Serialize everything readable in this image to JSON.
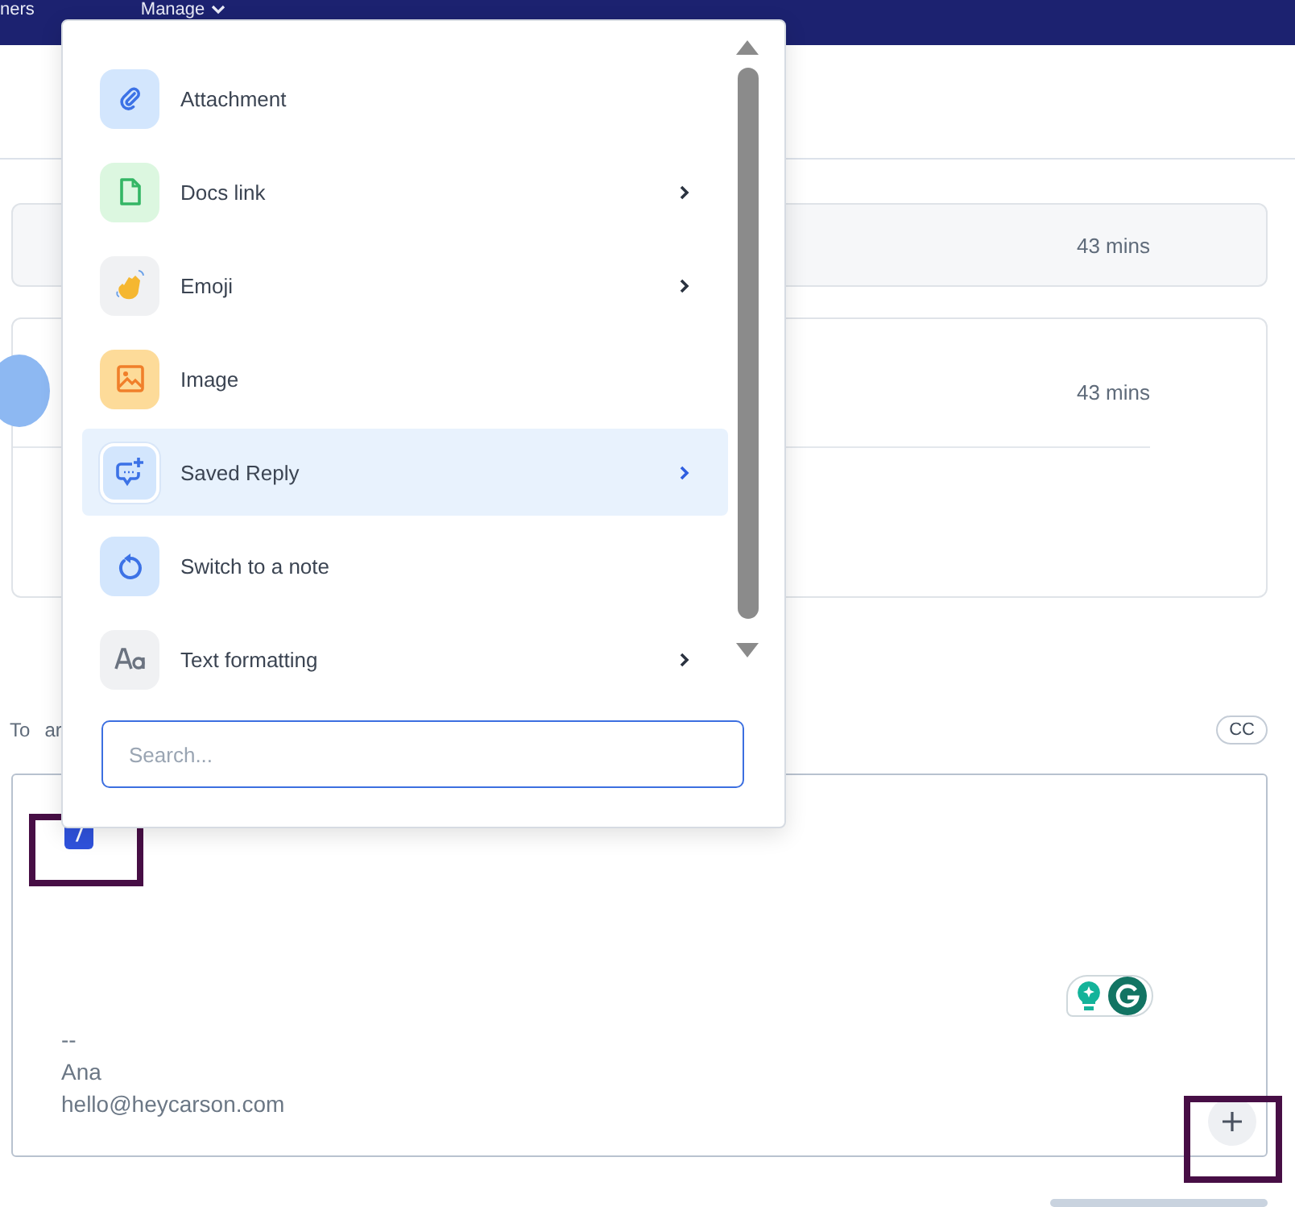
{
  "nav": {
    "items": [
      {
        "label": "ners",
        "dropdown": false
      },
      {
        "label": "Manage",
        "dropdown": true
      }
    ]
  },
  "messages": [
    {
      "kind": "collapsed",
      "time": "43 mins"
    },
    {
      "kind": "expanded",
      "time": "43 mins"
    }
  ],
  "recipient": {
    "label": "To",
    "value": "ar"
  },
  "cc_button": "CC",
  "compose": {
    "command": "/",
    "signature": [
      "--",
      "Ana",
      "hello@heycarson.com"
    ]
  },
  "insert_menu": {
    "items": [
      {
        "label": "Attachment",
        "submenu": false,
        "selected": false
      },
      {
        "label": "Docs link",
        "submenu": true,
        "selected": false
      },
      {
        "label": "Emoji",
        "submenu": true,
        "selected": false
      },
      {
        "label": "Image",
        "submenu": false,
        "selected": false
      },
      {
        "label": "Saved Reply",
        "submenu": true,
        "selected": true
      },
      {
        "label": "Switch to a note",
        "submenu": false,
        "selected": false
      },
      {
        "label": "Text formatting",
        "submenu": true,
        "selected": false
      }
    ],
    "search": {
      "placeholder": "Search..."
    }
  }
}
